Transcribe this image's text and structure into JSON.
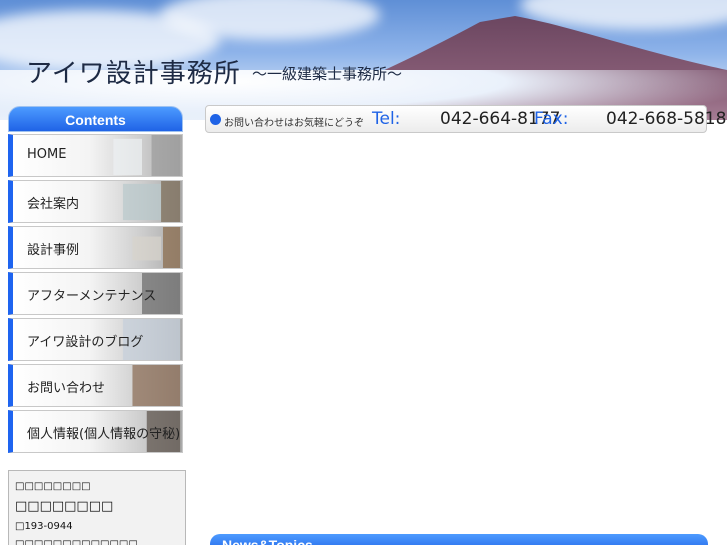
{
  "header": {
    "title": "アイワ設計事務所",
    "subtitle": "〜一級建築士事務所〜"
  },
  "sidebar": {
    "heading": "Contents",
    "items": [
      {
        "label": "HOME"
      },
      {
        "label": "会社案内"
      },
      {
        "label": "設計事例"
      },
      {
        "label": "アフターメンテナンス"
      },
      {
        "label": "アイワ設計のブログ"
      },
      {
        "label": "お問い合わせ"
      },
      {
        "label": "個人情報(個人情報の守秘)"
      }
    ],
    "info": {
      "line1": "□□□□□□□□",
      "line2": "□□□□□□□□",
      "line3": "□193-0944",
      "line4": "□□□□□□□□□□□□□"
    }
  },
  "contact": {
    "lead": "お問い合わせはお気軽にどうぞ",
    "tel_label": "Tel:",
    "tel": "042-664-8177",
    "fax_label": "Fax:",
    "fax": "042-668-5818"
  },
  "news": {
    "title": "News&Topics"
  },
  "colors": {
    "accent": "#1f63e6",
    "tab_top": "#4d9bff"
  }
}
